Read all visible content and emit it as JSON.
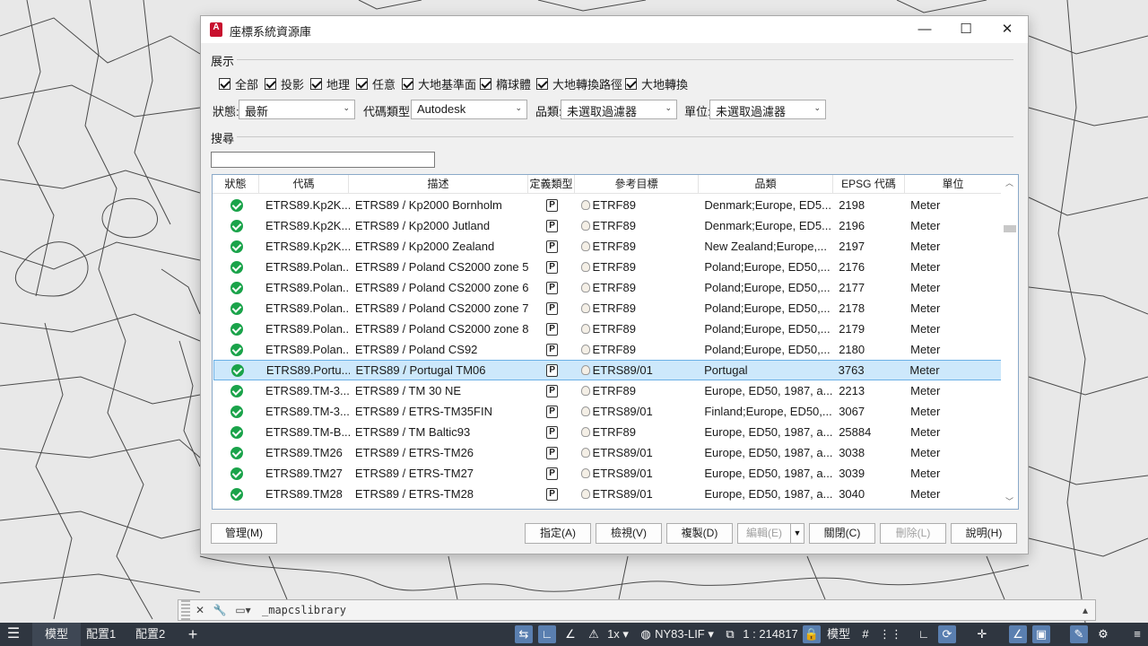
{
  "dialog": {
    "title": "座標系統資源庫",
    "display_section": "展示",
    "filters": [
      "全部",
      "投影",
      "地理",
      "任意",
      "大地基準面",
      "橢球體",
      "大地轉換路徑",
      "大地轉換"
    ],
    "status_label": "狀態:",
    "status_value": "最新",
    "code_type_label": "代碼類型:",
    "code_type_value": "Autodesk",
    "category_label": "品類:",
    "category_value": "未選取過濾器",
    "unit_label": "單位:",
    "unit_value": "未選取過濾器",
    "search_section": "搜尋",
    "search_value": ""
  },
  "table": {
    "columns": [
      "狀態",
      "代碼",
      "描述",
      "定義類型",
      "參考目標",
      "品類",
      "EPSG 代碼",
      "單位"
    ],
    "rows": [
      {
        "code": "ETRS89.Kp2K...",
        "desc": "ETRS89 / Kp2000 Bornholm",
        "type": "P",
        "ref": "ETRF89",
        "cat": "Denmark;Europe, ED5...",
        "epsg": "2198",
        "unit": "Meter"
      },
      {
        "code": "ETRS89.Kp2K...",
        "desc": "ETRS89 / Kp2000 Jutland",
        "type": "P",
        "ref": "ETRF89",
        "cat": "Denmark;Europe, ED5...",
        "epsg": "2196",
        "unit": "Meter"
      },
      {
        "code": "ETRS89.Kp2K...",
        "desc": "ETRS89 / Kp2000 Zealand",
        "type": "P",
        "ref": "ETRF89",
        "cat": "New Zealand;Europe,...",
        "epsg": "2197",
        "unit": "Meter"
      },
      {
        "code": "ETRS89.Polan...",
        "desc": "ETRS89 / Poland CS2000 zone 5",
        "type": "P",
        "ref": "ETRF89",
        "cat": "Poland;Europe, ED50,...",
        "epsg": "2176",
        "unit": "Meter"
      },
      {
        "code": "ETRS89.Polan...",
        "desc": "ETRS89 / Poland CS2000 zone 6",
        "type": "P",
        "ref": "ETRF89",
        "cat": "Poland;Europe, ED50,...",
        "epsg": "2177",
        "unit": "Meter"
      },
      {
        "code": "ETRS89.Polan...",
        "desc": "ETRS89 / Poland CS2000 zone 7",
        "type": "P",
        "ref": "ETRF89",
        "cat": "Poland;Europe, ED50,...",
        "epsg": "2178",
        "unit": "Meter"
      },
      {
        "code": "ETRS89.Polan...",
        "desc": "ETRS89 / Poland CS2000 zone 8",
        "type": "P",
        "ref": "ETRF89",
        "cat": "Poland;Europe, ED50,...",
        "epsg": "2179",
        "unit": "Meter"
      },
      {
        "code": "ETRS89.Polan...",
        "desc": "ETRS89 / Poland CS92",
        "type": "P",
        "ref": "ETRF89",
        "cat": "Poland;Europe, ED50,...",
        "epsg": "2180",
        "unit": "Meter"
      },
      {
        "code": "ETRS89.Portu...",
        "desc": "ETRS89 / Portugal TM06",
        "type": "P",
        "ref": "ETRS89/01",
        "cat": "Portugal",
        "epsg": "3763",
        "unit": "Meter"
      },
      {
        "code": "ETRS89.TM-3...",
        "desc": "ETRS89 / TM 30 NE",
        "type": "P",
        "ref": "ETRF89",
        "cat": "Europe, ED50, 1987, a...",
        "epsg": "2213",
        "unit": "Meter"
      },
      {
        "code": "ETRS89.TM-3...",
        "desc": "ETRS89 / ETRS-TM35FIN",
        "type": "P",
        "ref": "ETRS89/01",
        "cat": "Finland;Europe, ED50,...",
        "epsg": "3067",
        "unit": "Meter"
      },
      {
        "code": "ETRS89.TM-B...",
        "desc": "ETRS89 / TM Baltic93",
        "type": "P",
        "ref": "ETRF89",
        "cat": "Europe, ED50, 1987, a...",
        "epsg": "25884",
        "unit": "Meter"
      },
      {
        "code": "ETRS89.TM26",
        "desc": "ETRS89 / ETRS-TM26",
        "type": "P",
        "ref": "ETRS89/01",
        "cat": "Europe, ED50, 1987, a...",
        "epsg": "3038",
        "unit": "Meter"
      },
      {
        "code": "ETRS89.TM27",
        "desc": "ETRS89 / ETRS-TM27",
        "type": "P",
        "ref": "ETRS89/01",
        "cat": "Europe, ED50, 1987, a...",
        "epsg": "3039",
        "unit": "Meter"
      },
      {
        "code": "ETRS89.TM28",
        "desc": "ETRS89 / ETRS-TM28",
        "type": "P",
        "ref": "ETRS89/01",
        "cat": "Europe, ED50, 1987, a...",
        "epsg": "3040",
        "unit": "Meter"
      }
    ],
    "selected_row": 8
  },
  "buttons": {
    "manage": "管理(M)",
    "assign": "指定(A)",
    "view": "檢視(V)",
    "copy": "複製(D)",
    "edit": "編輯(E)",
    "close": "關閉(C)",
    "delete": "刪除(L)",
    "help": "說明(H)"
  },
  "command_line": {
    "text": "_mapcslibrary"
  },
  "statusbar": {
    "model_tab": "模型",
    "layout1": "配置1",
    "layout2": "配置2",
    "scale_factor": "1x",
    "coord_system": "NY83-LIF",
    "scale": "1 : 214817",
    "space": "模型"
  },
  "colors": {
    "accent": "#c8102e",
    "status_ok": "#1aa34a",
    "selection": "#cde8fb",
    "statusbar_bg": "#2f3640"
  }
}
